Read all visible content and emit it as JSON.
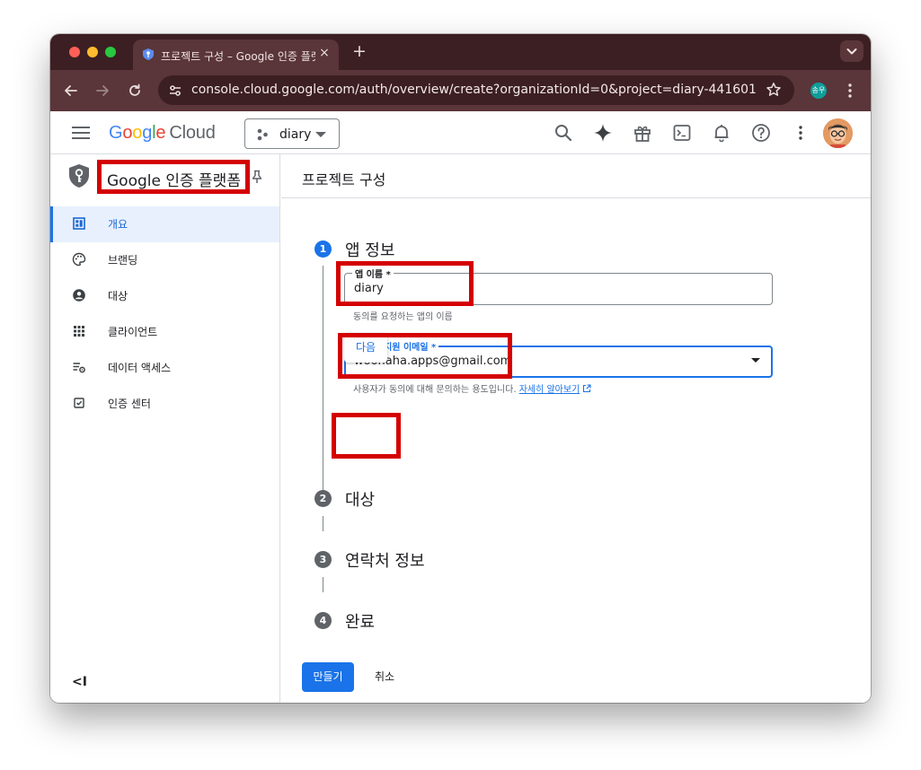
{
  "browser": {
    "tab_title": "프로젝트 구성 – Google 인증 플랫폼",
    "tab_close_glyph": "×",
    "new_tab_glyph": "+",
    "url": "console.cloud.google.com/auth/overview/create?organizationId=0&project=diary-441601",
    "profile_initials": "송우"
  },
  "header": {
    "logo_text": "Google",
    "logo_product": "Cloud",
    "project_name": "diary",
    "icons": [
      "search-icon",
      "gemini-icon",
      "gift-icon",
      "cloud-shell-icon",
      "notifications-icon",
      "help-icon",
      "more-vert-icon"
    ]
  },
  "sidebar": {
    "title": "Google 인증 플랫폼",
    "items": [
      {
        "label": "개요",
        "icon": "dashboard-icon",
        "active": true
      },
      {
        "label": "브랜딩",
        "icon": "palette-icon",
        "active": false
      },
      {
        "label": "대상",
        "icon": "account-circle-icon",
        "active": false
      },
      {
        "label": "클라이언트",
        "icon": "apps-grid-icon",
        "active": false
      },
      {
        "label": "데이터 액세스",
        "icon": "data-settings-icon",
        "active": false
      },
      {
        "label": "인증 센터",
        "icon": "checkbox-icon",
        "active": false
      }
    ],
    "collapse_glyph": "<I"
  },
  "main": {
    "page_title": "프로젝트 구성",
    "steps": [
      {
        "number": "1",
        "title": "앱 정보"
      },
      {
        "number": "2",
        "title": "대상"
      },
      {
        "number": "3",
        "title": "연락처 정보"
      },
      {
        "number": "4",
        "title": "완료"
      }
    ],
    "app_name": {
      "label": "앱 이름 *",
      "value": "diary",
      "hint": "동의를 요청하는 앱의 이름"
    },
    "support_email": {
      "label": "사용자 지원 이메일 *",
      "value": "woohaha.apps@gmail.com",
      "hint": "사용자가 동의에 대해 문의하는 용도입니다.",
      "learn_more": "자세히 알아보기"
    },
    "next_button": "다음",
    "create_button": "만들기",
    "cancel_button": "취소"
  },
  "colors": {
    "accent": "#1a73e8",
    "highlight_box": "#d40000",
    "browser_frame": "#3c1f22"
  }
}
